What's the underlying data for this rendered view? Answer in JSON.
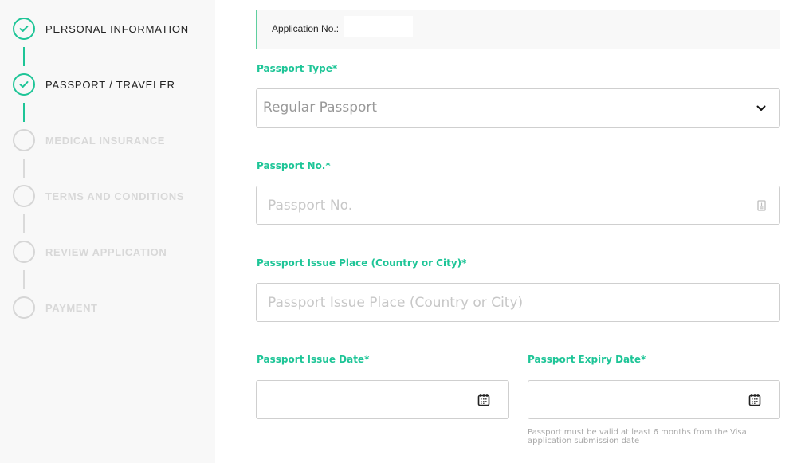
{
  "sidebar": {
    "steps": [
      {
        "label": "PERSONAL INFORMATION",
        "status": "completed",
        "icon": "check-icon"
      },
      {
        "label": "PASSPORT / TRAVELER",
        "status": "completed",
        "icon": "check-icon"
      },
      {
        "label": "MEDICAL INSURANCE",
        "status": "pending",
        "icon": "empty-circle-icon"
      },
      {
        "label": "TERMS AND CONDITIONS",
        "status": "pending",
        "icon": "empty-circle-icon"
      },
      {
        "label": "REVIEW APPLICATION",
        "status": "pending",
        "icon": "empty-circle-icon"
      },
      {
        "label": "PAYMENT",
        "status": "pending",
        "icon": "empty-circle-icon"
      }
    ]
  },
  "application": {
    "label": "Application No.:",
    "value": ""
  },
  "form": {
    "passport_type": {
      "label": "Passport Type*",
      "selected": "Regular Passport",
      "icon": "chevron-down-icon"
    },
    "passport_no": {
      "label": "Passport No.*",
      "placeholder": "Passport No.",
      "value": "",
      "icon": "id-card-icon"
    },
    "issue_place": {
      "label": "Passport Issue Place (Country or City)*",
      "placeholder": "Passport Issue Place (Country or City)",
      "value": ""
    },
    "issue_date": {
      "label": "Passport Issue Date*",
      "value": "",
      "icon": "calendar-icon"
    },
    "expiry_date": {
      "label": "Passport Expiry Date*",
      "value": "",
      "icon": "calendar-icon",
      "hint": "Passport must be valid at least 6 months from the Visa application submission date"
    }
  },
  "colors": {
    "accent": "#1ec597",
    "sidebar_bg": "#f8f8f8",
    "pending": "#d6d6d6"
  }
}
